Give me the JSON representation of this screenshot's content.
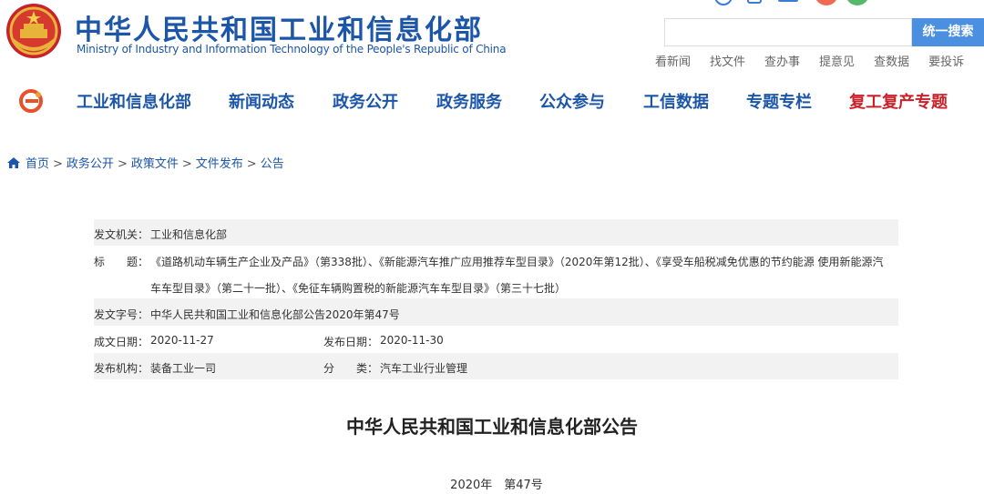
{
  "header": {
    "title": "中华人民共和国工业和信息化部",
    "subtitle": "Ministry of Industry and Information Technology of the People's Republic of China",
    "search_button": "统一搜索",
    "search_placeholder": "",
    "quick_links": [
      "看新闻",
      "找文件",
      "查办事",
      "提意见",
      "查数据",
      "要投诉"
    ]
  },
  "nav": {
    "items": [
      "工业和信息化部",
      "新闻动态",
      "政务公开",
      "政务服务",
      "公众参与",
      "工信数据",
      "专题专栏",
      "复工复产专题"
    ]
  },
  "breadcrumb": [
    "首页",
    "政务公开",
    "政策文件",
    "文件发布",
    "公告"
  ],
  "info": {
    "issuer_label": "发文机关：",
    "issuer": "工业和信息化部",
    "title_label": "标　　题：",
    "title_line1": "《道路机动车辆生产企业及产品》（第338批）、《新能源汽车推广应用推荐车型目录》（2020年第12批）、《享受车船税减免优惠的节约能源 使用新能源汽",
    "title_line2": "车车型目录》（第二十一批）、《免征车辆购置税的新能源汽车车型目录》（第三十七批）",
    "doc_no_label": "发文字号：",
    "doc_no": "中华人民共和国工业和信息化部公告2020年第47号",
    "date_label": "成文日期：",
    "date": "2020-11-27",
    "publish_label": "发布日期：",
    "publish_date": "2020-11-30",
    "org_label": "发布机构：",
    "org": "装备工业一司",
    "category_label": "分　　类：",
    "category": "汽车工业行业管理"
  },
  "document": {
    "heading": "中华人民共和国工业和信息化部公告",
    "number": "2020年　第47号"
  },
  "colors": {
    "brand_blue": "#1c56a8",
    "special_red": "#c9222b",
    "search_blue": "#4a8fe0"
  }
}
